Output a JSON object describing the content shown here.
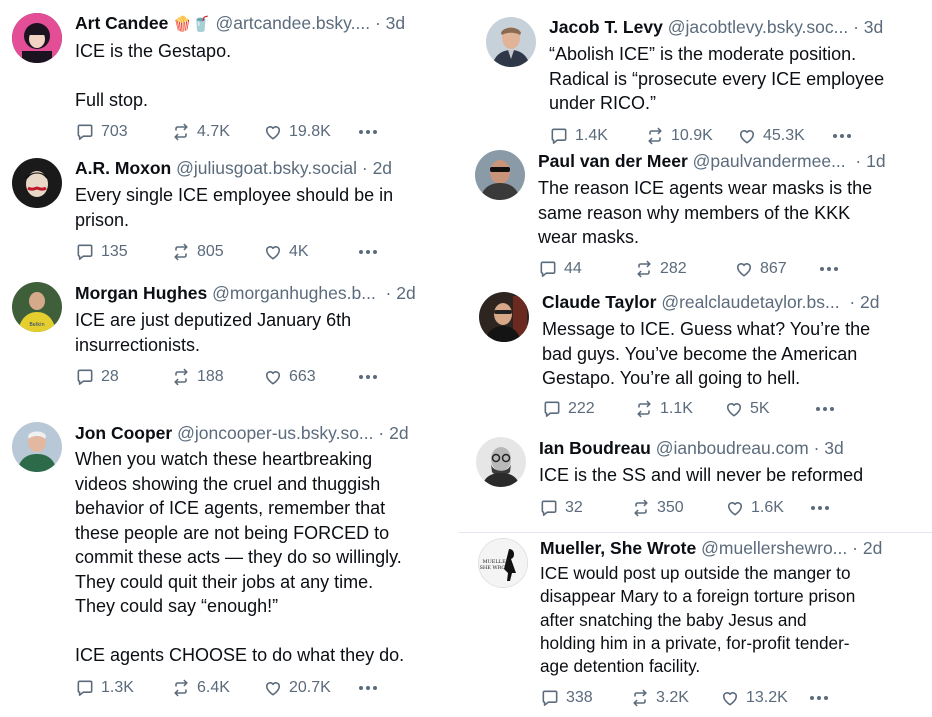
{
  "posts": [
    {
      "name": "Art Candee",
      "emoji": "🍿🥤",
      "handle": "@artcandee.bsky....",
      "time": "3d",
      "text": "ICE is the Gestapo.\n\nFull stop.",
      "replies": "703",
      "reposts": "4.7K",
      "likes": "19.8K",
      "avatar_color": "#2c2233"
    },
    {
      "name": "A.R. Moxon",
      "handle": "@juliusgoat.bsky.social",
      "time": "2d",
      "text": "Every single ICE employee should be in\nprison.",
      "replies": "135",
      "reposts": "805",
      "likes": "4K",
      "avatar_color": "#1a1a1a"
    },
    {
      "name": "Morgan Hughes",
      "handle": "@morganhughes.b...",
      "time": "2d",
      "text": "ICE are just deputized January 6th\ninsurrectionists.",
      "replies": "28",
      "reposts": "188",
      "likes": "663",
      "avatar_color": "#d7c23a"
    },
    {
      "name": "Jon Cooper",
      "handle": "@joncooper-us.bsky.so...",
      "time": "2d",
      "text": "When you watch these heartbreaking\nvideos showing the cruel and thuggish\nbehavior of ICE agents, remember that\nthese people are not being FORCED to\ncommit these acts — they do so willingly.\nThey could quit their jobs at any time.\nThey could say “enough!”\n\nICE agents CHOOSE to do what they do.",
      "replies": "1.3K",
      "reposts": "6.4K",
      "likes": "20.7K",
      "avatar_color": "#8fa3b5"
    },
    {
      "name": "Jacob T. Levy",
      "handle": "@jacobtlevy.bsky.soc...",
      "time": "3d",
      "text": "“Abolish ICE” is the moderate position.\nRadical is “prosecute every ICE employee\nunder RICO.”",
      "replies": "1.4K",
      "reposts": "10.9K",
      "likes": "45.3K",
      "avatar_color": "#c0ccd6"
    },
    {
      "name": "Paul van der Meer",
      "handle": "@paulvandermee...",
      "time": "1d",
      "text": "The reason ICE agents wear masks is the\nsame reason why members of the KKK\nwear masks.",
      "replies": "44",
      "reposts": "282",
      "likes": "867",
      "avatar_color": "#7a8a96"
    },
    {
      "name": "Claude Taylor",
      "handle": "@realclaudetaylor.bs...",
      "time": "2d",
      "text": "Message to ICE. Guess what? You’re the\nbad guys. You’ve become the American\nGestapo. You’re all going to hell.",
      "replies": "222",
      "reposts": "1.1K",
      "likes": "5K",
      "avatar_color": "#3a2a22"
    },
    {
      "name": "Ian Boudreau",
      "handle": "@ianboudreau.com",
      "time": "3d",
      "text": "ICE is the SS and will never be reformed",
      "replies": "32",
      "reposts": "350",
      "likes": "1.6K",
      "avatar_color": "#555555"
    },
    {
      "name": "Mueller, She Wrote",
      "handle": "@muellershewro...",
      "time": "2d",
      "text": "ICE would post up outside the manger to\ndisappear Mary to a foreign torture prison\nafter snatching the baby Jesus and\nholding him in a private, for-profit tender-\nage detention facility.",
      "replies": "338",
      "reposts": "3.2K",
      "likes": "13.2K",
      "avatar_color": "#f2f2f2",
      "avatar_logo_text": "MUELLER SHE WROTE"
    }
  ]
}
